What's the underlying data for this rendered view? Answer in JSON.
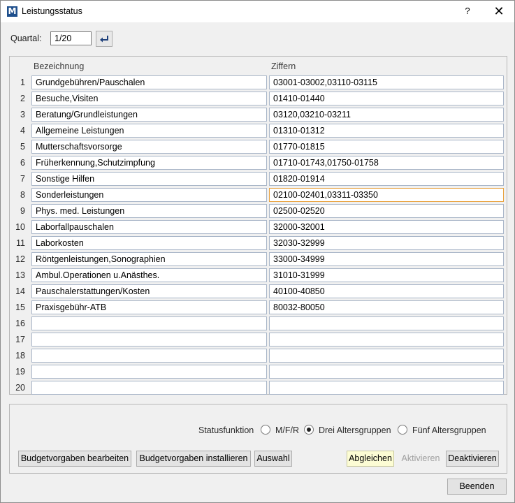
{
  "window": {
    "title": "Leistungsstatus",
    "help": "?",
    "close": "✕"
  },
  "quartal": {
    "label": "Quartal:",
    "value": "1/20"
  },
  "grid": {
    "headers": {
      "name": "Bezeichnung",
      "code": "Ziffern"
    },
    "rows": [
      {
        "num": "1",
        "name": "Grundgebühren/Pauschalen",
        "code": "03001-03002,03110-03115"
      },
      {
        "num": "2",
        "name": "Besuche,Visiten",
        "code": "01410-01440"
      },
      {
        "num": "3",
        "name": "Beratung/Grundleistungen",
        "code": "03120,03210-03211"
      },
      {
        "num": "4",
        "name": "Allgemeine Leistungen",
        "code": "01310-01312"
      },
      {
        "num": "5",
        "name": "Mutterschaftsvorsorge",
        "code": "01770-01815"
      },
      {
        "num": "6",
        "name": "Früherkennung,Schutzimpfung",
        "code": "01710-01743,01750-01758"
      },
      {
        "num": "7",
        "name": "Sonstige Hilfen",
        "code": "01820-01914"
      },
      {
        "num": "8",
        "name": "Sonderleistungen",
        "code": "02100-02401,03311-03350"
      },
      {
        "num": "9",
        "name": "Phys. med. Leistungen",
        "code": "02500-02520"
      },
      {
        "num": "10",
        "name": "Laborfallpauschalen",
        "code": "32000-32001"
      },
      {
        "num": "11",
        "name": "Laborkosten",
        "code": "32030-32999"
      },
      {
        "num": "12",
        "name": "Röntgenleistungen,Sonographien",
        "code": "33000-34999"
      },
      {
        "num": "13",
        "name": "Ambul.Operationen u.Anästhes.",
        "code": "31010-31999"
      },
      {
        "num": "14",
        "name": "Pauschalerstattungen/Kosten",
        "code": "40100-40850"
      },
      {
        "num": "15",
        "name": "Praxisgebühr-ATB",
        "code": "80032-80050"
      },
      {
        "num": "16",
        "name": "",
        "code": ""
      },
      {
        "num": "17",
        "name": "",
        "code": ""
      },
      {
        "num": "18",
        "name": "",
        "code": ""
      },
      {
        "num": "19",
        "name": "",
        "code": ""
      },
      {
        "num": "20",
        "name": "",
        "code": ""
      }
    ]
  },
  "status": {
    "label": "Statusfunktion",
    "options": [
      "M/F/R",
      "Drei Altersgruppen",
      "Fünf Altersgruppen"
    ],
    "selected": "Drei Altersgruppen"
  },
  "buttons": {
    "budget_edit": "Budgetvorgaben bearbeiten",
    "budget_install": "Budgetvorgaben installieren",
    "auswahl": "Auswahl",
    "abgleichen": "Abgleichen",
    "aktivieren": "Aktivieren",
    "deaktivieren": "Deaktivieren",
    "beenden": "Beenden"
  },
  "colors": {
    "app_icon": "#1e4f8c",
    "focus_border": "#e8a13c",
    "highlight_button": "#fcfcd4"
  }
}
